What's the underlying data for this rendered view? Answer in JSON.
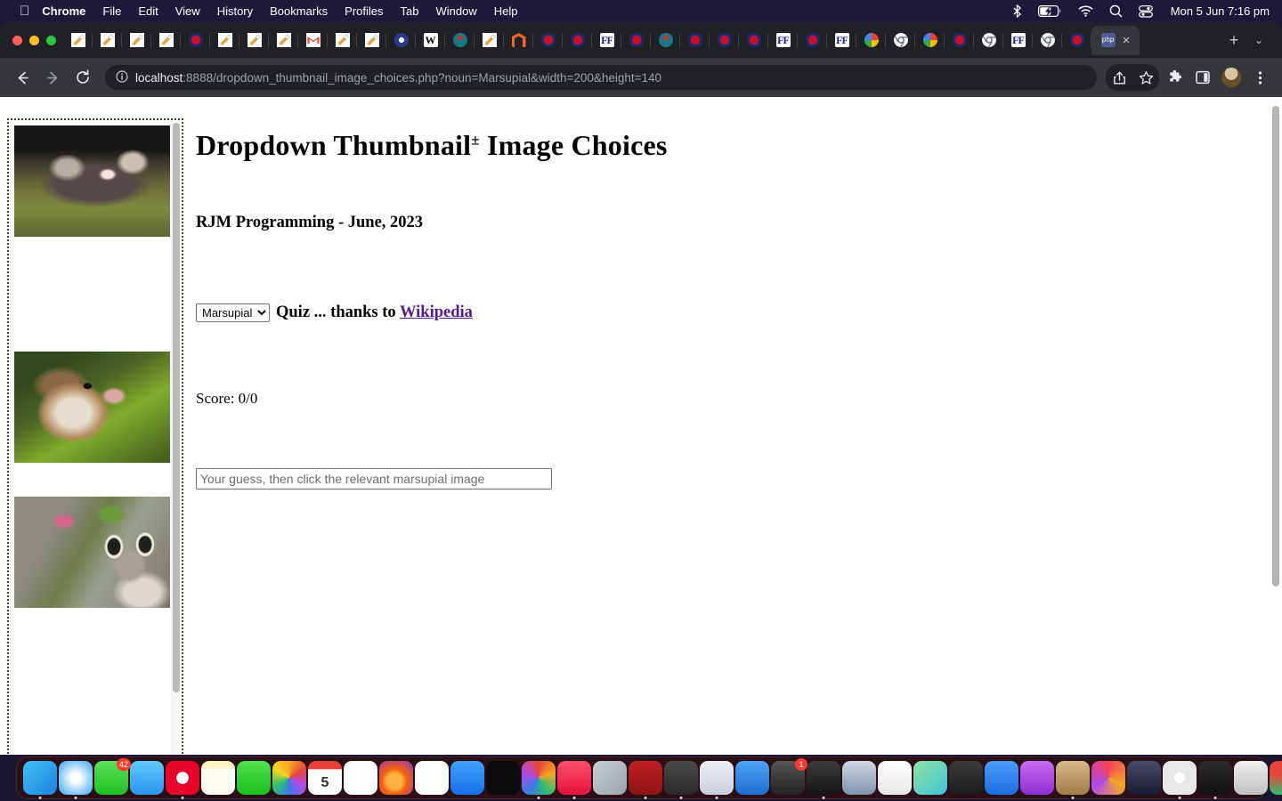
{
  "menubar": {
    "apple_icon": "apple-icon",
    "items": [
      {
        "label": "Chrome",
        "bold": true
      },
      {
        "label": "File",
        "bold": false
      },
      {
        "label": "Edit",
        "bold": false
      },
      {
        "label": "View",
        "bold": false
      },
      {
        "label": "History",
        "bold": false
      },
      {
        "label": "Bookmarks",
        "bold": false
      },
      {
        "label": "Profiles",
        "bold": false
      },
      {
        "label": "Tab",
        "bold": false
      },
      {
        "label": "Window",
        "bold": false
      },
      {
        "label": "Help",
        "bold": false
      }
    ],
    "status_icons": [
      "bluetooth-icon",
      "battery-charging-icon",
      "wifi-icon",
      "search-icon",
      "control-center-icon"
    ],
    "clock": "Mon 5 Jun  7:16 pm"
  },
  "browser": {
    "tabs": [
      {
        "favicon": "mail-icon",
        "active": false
      },
      {
        "favicon": "mail-icon",
        "active": false
      },
      {
        "favicon": "mail-icon",
        "active": false
      },
      {
        "favicon": "mail-icon",
        "active": false
      },
      {
        "favicon": "afl-icon",
        "active": false
      },
      {
        "favicon": "mail-icon",
        "active": false
      },
      {
        "favicon": "mail-icon",
        "active": false
      },
      {
        "favicon": "mail-icon",
        "active": false
      },
      {
        "favicon": "gmail-icon",
        "active": false
      },
      {
        "favicon": "mail-icon",
        "active": false
      },
      {
        "favicon": "mail-icon",
        "active": false
      },
      {
        "favicon": "opera-icon",
        "active": false
      },
      {
        "favicon": "wikipedia-icon",
        "active": false
      },
      {
        "favicon": "teal-icon",
        "active": false
      },
      {
        "favicon": "mail-icon",
        "active": false
      },
      {
        "favicon": "magento-icon",
        "active": false
      },
      {
        "favicon": "afl-icon",
        "active": false
      },
      {
        "favicon": "afl-icon",
        "active": false
      },
      {
        "favicon": "ff-icon",
        "active": false
      },
      {
        "favicon": "afl-icon",
        "active": false
      },
      {
        "favicon": "teal-icon",
        "active": false
      },
      {
        "favicon": "afl-icon",
        "active": false
      },
      {
        "favicon": "afl-icon",
        "active": false
      },
      {
        "favicon": "afl-icon",
        "active": false
      },
      {
        "favicon": "ff-icon",
        "active": false
      },
      {
        "favicon": "afl-icon",
        "active": false
      },
      {
        "favicon": "ff-icon",
        "active": false
      },
      {
        "favicon": "google-icon",
        "active": false
      },
      {
        "favicon": "chrome-icon",
        "active": false
      },
      {
        "favicon": "google-icon",
        "active": false
      },
      {
        "favicon": "afl-icon",
        "active": false
      },
      {
        "favicon": "chrome-icon",
        "active": false
      },
      {
        "favicon": "ff-icon",
        "active": false
      },
      {
        "favicon": "chrome-icon",
        "active": false
      },
      {
        "favicon": "afl-icon",
        "active": false
      },
      {
        "favicon": "php-icon",
        "label": "php",
        "active": true
      }
    ],
    "tab_close_label": "×",
    "new_tab_label": "+",
    "tab_list_label": "⌄",
    "nav": {
      "back_label": "←",
      "forward_label": "→",
      "reload_label": "↻"
    },
    "omnibox": {
      "info_icon": "site-info-icon",
      "url_host": "localhost",
      "url_rest": ":8888/dropdown_thumbnail_image_choices.php?noun=Marsupial&width=200&height=140"
    },
    "toolbar_right_icons": [
      "share-icon",
      "bookmark-star-icon",
      "extensions-puzzle-icon",
      "side-panel-icon",
      "profile-avatar",
      "chrome-menu-icon"
    ]
  },
  "page": {
    "title_main": "Dropdown Thumbnail",
    "title_sup": "±",
    "title_tail": " Image Choices",
    "byline": "RJM Programming - June, 2023",
    "noun_select": {
      "selected": "Marsupial",
      "options": [
        "Marsupial"
      ]
    },
    "quiz_text_before": "Quiz ... thanks to ",
    "quiz_link_label": "Wikipedia",
    "score_label": "Score: 0/0",
    "guess_input": {
      "value": "",
      "placeholder": "Your guess, then click the relevant marsupial image"
    },
    "thumbnails": [
      {
        "name": "marsupial-thumbnail-1",
        "alt": "bandicoot photo"
      },
      {
        "name": "marsupial-thumbnail-2",
        "alt": "possum photo"
      },
      {
        "name": "marsupial-thumbnail-3",
        "alt": "wallaby photo"
      }
    ],
    "colors": {
      "link_visited": "#551a8b",
      "iframe_border": "#2d4a18",
      "background": "#ffffff"
    }
  },
  "dock": {
    "apps": [
      {
        "name": "finder",
        "running": true
      },
      {
        "name": "safari",
        "running": true
      },
      {
        "name": "messages",
        "running": false,
        "badge": "42"
      },
      {
        "name": "mail",
        "running": false
      },
      {
        "name": "opera",
        "running": true
      },
      {
        "name": "notes",
        "running": false
      },
      {
        "name": "facetime",
        "running": false
      },
      {
        "name": "photos",
        "running": false
      },
      {
        "name": "calendar",
        "running": false,
        "label": "5"
      },
      {
        "name": "reminders",
        "running": false
      },
      {
        "name": "firefox",
        "running": false
      },
      {
        "name": "news",
        "running": false
      },
      {
        "name": "app-store",
        "running": false
      },
      {
        "name": "apple-tv",
        "running": false
      },
      {
        "name": "preview-paint",
        "running": true
      },
      {
        "name": "music",
        "running": true
      },
      {
        "name": "launchpad",
        "running": false
      },
      {
        "name": "filezilla",
        "running": true
      },
      {
        "name": "calculator",
        "running": true
      },
      {
        "name": "bbedit",
        "running": true
      },
      {
        "name": "xcode",
        "running": false
      },
      {
        "name": "adobe",
        "running": false,
        "badge": "1"
      },
      {
        "name": "mamp",
        "running": true
      },
      {
        "name": "scanner",
        "running": false
      },
      {
        "name": "textedit-doc",
        "running": false
      },
      {
        "name": "maps",
        "running": false
      },
      {
        "name": "gimp",
        "running": false
      },
      {
        "name": "zoom",
        "running": false
      },
      {
        "name": "podcasts",
        "running": false
      },
      {
        "name": "logic",
        "running": true
      },
      {
        "name": "intellij",
        "running": false
      },
      {
        "name": "quicktime",
        "running": false
      },
      {
        "name": "chrome",
        "running": true
      },
      {
        "name": "terminal",
        "running": true
      },
      {
        "name": "inkscape",
        "running": false
      },
      {
        "name": "autocad",
        "running": false
      }
    ],
    "second_group": [
      {
        "name": "pdf-reader"
      },
      {
        "name": "mamp-pro"
      },
      {
        "name": "stickies"
      }
    ],
    "minimized": [
      {
        "name": "document-window"
      },
      {
        "name": "chrome-window"
      },
      {
        "name": "browser-window"
      },
      {
        "name": "browser-window"
      },
      {
        "name": "browser-window"
      },
      {
        "name": "browser-window"
      },
      {
        "name": "browser-window"
      },
      {
        "name": "browser-window"
      },
      {
        "name": "browser-window"
      },
      {
        "name": "browser-window"
      },
      {
        "name": "browser-window"
      }
    ],
    "trash": {
      "name": "trash"
    }
  }
}
